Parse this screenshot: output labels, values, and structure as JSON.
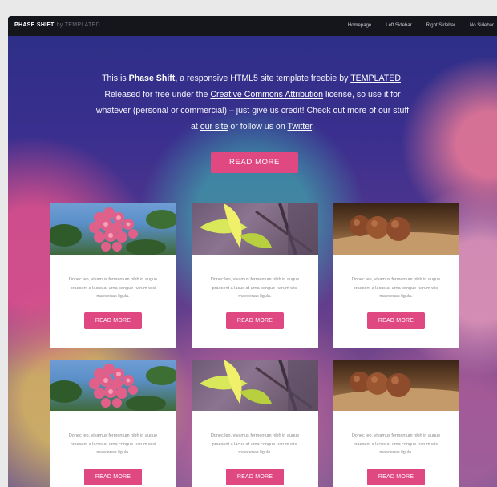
{
  "navbar": {
    "brand": "PHASE SHIFT",
    "brand_by": "by TEMPLATED",
    "links": [
      "Homepage",
      "Left Sidebar",
      "Right Sidebar",
      "No Sidebar"
    ]
  },
  "hero": {
    "line1_pre": "This is ",
    "line1_bold": "Phase Shift",
    "line1_post": ", a responsive HTML5 site template freebie by ",
    "link_templated": "TEMPLATED",
    "line1_end": ".",
    "line2_pre": "Released for free under the ",
    "link_cc": "Creative Commons Attribution",
    "line2_post": " license, so use it for",
    "line3": "whatever (personal or commercial) – just give us credit! Check out more of our stuff",
    "line4_pre": "at ",
    "link_site": "our site",
    "line4_mid": " or follow us on ",
    "link_twitter": "Twitter",
    "line4_end": ".",
    "button": "READ MORE"
  },
  "cards": [
    {
      "image": "flower-image",
      "text": "Donec leo, vivamus fermentum nibh in augue praesent a lacus at urna congue rutrum wisi maecenas ligula.",
      "button": "READ MORE"
    },
    {
      "image": "leaf-image",
      "text": "Donec leo, vivamus fermentum nibh in augue praesent a lacus at urna congue rutrum wisi maecenas ligula.",
      "button": "READ MORE"
    },
    {
      "image": "seeds-image",
      "text": "Donec leo, vivamus fermentum nibh in augue praesent a lacus at urna congue rutrum wisi maecenas ligula.",
      "button": "READ MORE"
    },
    {
      "image": "flower-image",
      "text": "Donec leo, vivamus fermentum nibh in augue praesent a lacus at urna congue rutrum wisi maecenas ligula.",
      "button": "READ MORE"
    },
    {
      "image": "leaf-image",
      "text": "Donec leo, vivamus fermentum nibh in augue praesent a lacus at urna congue rutrum wisi maecenas ligula.",
      "button": "READ MORE"
    },
    {
      "image": "seeds-image",
      "text": "Donec leo, vivamus fermentum nibh in augue praesent a lacus at urna congue rutrum wisi maecenas ligula.",
      "button": "READ MORE"
    }
  ],
  "colors": {
    "accent": "#e04882",
    "navbar": "#14161c"
  }
}
